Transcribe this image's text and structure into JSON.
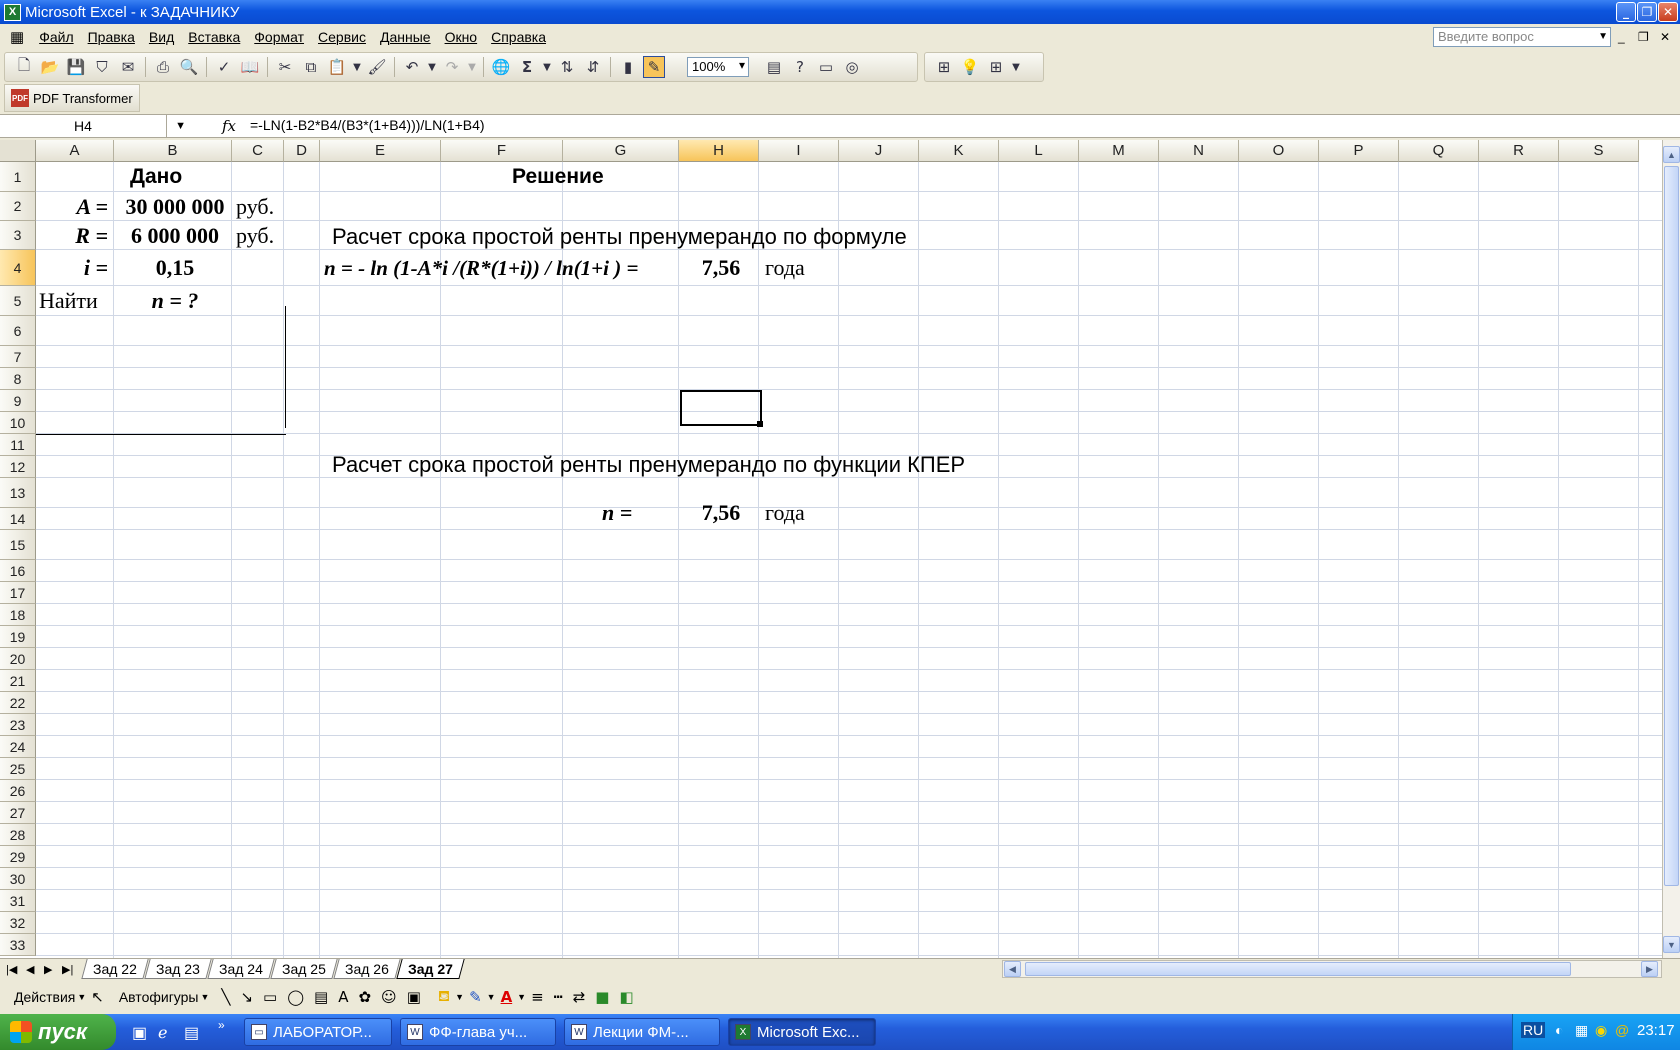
{
  "window": {
    "title": "Microsoft Excel - к ЗАДАЧНИКУ"
  },
  "menu": [
    "Файл",
    "Правка",
    "Вид",
    "Вставка",
    "Формат",
    "Сервис",
    "Данные",
    "Окно",
    "Справка"
  ],
  "help_placeholder": "Введите вопрос",
  "toolbar": {
    "zoom": "100%"
  },
  "pdf_toolbar": {
    "label": "PDF Transformer",
    "icon_text": "PDF"
  },
  "formula_bar": {
    "name_box": "H4",
    "fx": "fx",
    "formula": "=-LN(1-B2*B4/(B3*(1+B4)))/LN(1+B4)"
  },
  "columns": [
    "A",
    "B",
    "C",
    "D",
    "E",
    "F",
    "G",
    "H",
    "I",
    "J",
    "K",
    "L",
    "M",
    "N",
    "O",
    "P",
    "Q",
    "R",
    "S"
  ],
  "rows": [
    "1",
    "2",
    "3",
    "4",
    "5",
    "6",
    "7",
    "8",
    "9",
    "10",
    "11",
    "12",
    "13",
    "14",
    "15",
    "16",
    "17",
    "18",
    "19",
    "20",
    "21",
    "22",
    "23",
    "24",
    "25",
    "26",
    "27",
    "28",
    "29",
    "30",
    "31",
    "32",
    "33"
  ],
  "cells": {
    "given_title": "Дано",
    "solution_title": "Решение",
    "a_label": "A =",
    "a_value": "30 000 000",
    "a_unit": "руб.",
    "r_label": "R =",
    "r_value": "6 000 000",
    "r_unit": "руб.",
    "i_label": "i =",
    "i_value": "0,15",
    "find_label": "Найти",
    "find_value": "n = ?",
    "formula_heading": "Расчет срока простой ренты пренумерандо по формуле",
    "formula_text": "n = - ln (1-A*i /(R*(1+i)) / ln(1+i )   =",
    "formula_result": "7,56",
    "formula_unit": "года",
    "kper_heading": "Расчет срока простой ренты пренумерандо по функции КПЕР",
    "kper_label": "n   =",
    "kper_result": "7,56",
    "kper_unit": "года"
  },
  "sheet_tabs": [
    "Зад 22",
    "Зад 23",
    "Зад 24",
    "Зад 25",
    "Зад 26",
    "Зад 27"
  ],
  "active_tab": "Зад 27",
  "drawing_toolbar": {
    "actions": "Действия",
    "autoshapes": "Автофигуры"
  },
  "taskbar": {
    "start": "пуск",
    "items": [
      "ЛАБОРАТОР...",
      "ФФ-глава уч...",
      "Лекции ФМ-...",
      "Microsoft Exc..."
    ],
    "lang": "RU",
    "clock": "23:17"
  },
  "colors": {
    "selection_header": "#f7c45a",
    "gridline": "#d0d7e5",
    "title_bar": "#0c55de"
  }
}
